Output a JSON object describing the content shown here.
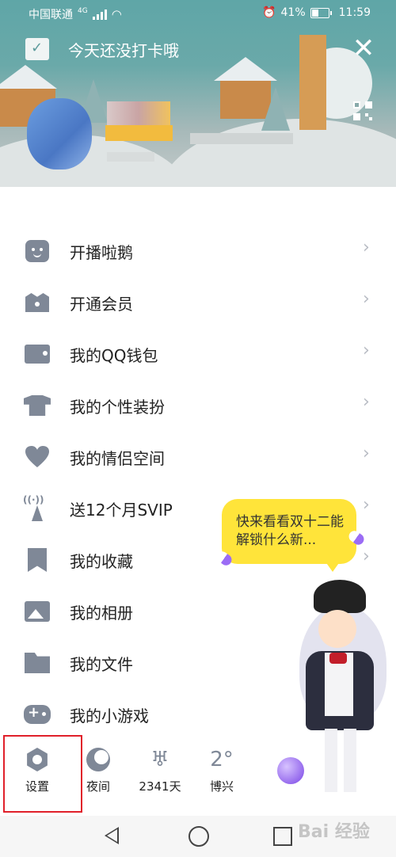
{
  "status_bar": {
    "carrier": "中国联通",
    "network": "4G",
    "battery": "41%",
    "time": "11:59"
  },
  "header": {
    "checkin_title": "今天还没打卡哦",
    "close": "✕"
  },
  "menu": [
    {
      "label": "开播啦鹅",
      "icon": "robot-icon"
    },
    {
      "label": "开通会员",
      "icon": "crown-icon"
    },
    {
      "label": "我的QQ钱包",
      "icon": "wallet-icon"
    },
    {
      "label": "我的个性装扮",
      "icon": "shirt-icon"
    },
    {
      "label": "我的情侣空间",
      "icon": "heart-icon"
    },
    {
      "label": "送12个月SVIP",
      "icon": "broadcast-tower-icon"
    },
    {
      "label": "我的收藏",
      "icon": "bookmark-icon"
    },
    {
      "label": "我的相册",
      "icon": "photo-icon"
    },
    {
      "label": "我的文件",
      "icon": "folder-icon"
    },
    {
      "label": "我的小游戏",
      "icon": "gamepad-icon"
    }
  ],
  "arrow": "›",
  "bubble": {
    "text": "快来看看双十二能解锁什么新..."
  },
  "bottom_bar": {
    "settings": "设置",
    "night": "夜间",
    "days": "2341天",
    "weather_temp": "2°",
    "weather_city": "博兴"
  },
  "watermark": "Bai 经验",
  "colors": {
    "accent_icon": "#7f8897",
    "highlight_box": "#e0202a",
    "bubble": "#ffe43a"
  }
}
